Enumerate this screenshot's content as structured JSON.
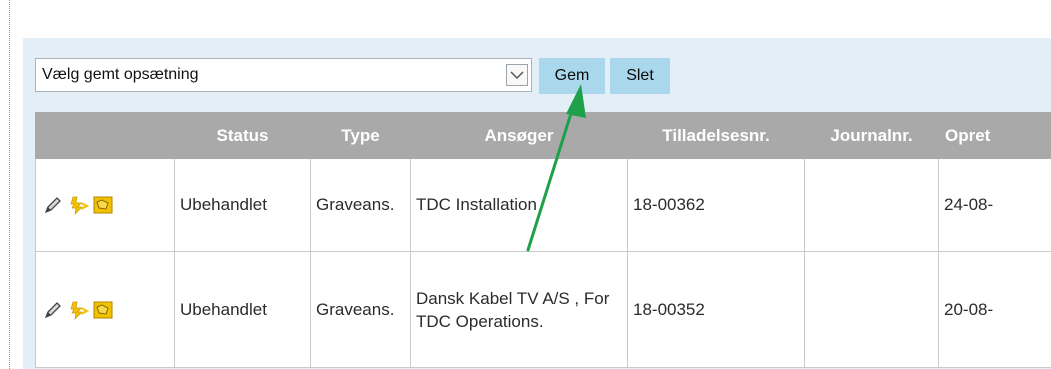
{
  "toolbar": {
    "saved_setup_select": "Vælg gemt opsætning",
    "gem_label": "Gem",
    "slet_label": "Slet"
  },
  "table": {
    "headers": [
      "",
      "Status",
      "Type",
      "Ansøger",
      "Tilladelsesnr.",
      "Journalnr.",
      "Opret"
    ],
    "rows": [
      {
        "status": "Ubehandlet",
        "type": "Graveans.",
        "ansoger": "TDC Installation",
        "tilladelsesnr": "18-00362",
        "journalnr": "",
        "oprettet": "24-08-"
      },
      {
        "status": "Ubehandlet",
        "type": "Graveans.",
        "ansoger": "Dansk Kabel TV A/S , For TDC Operations.",
        "tilladelsesnr": "18-00352",
        "journalnr": "",
        "oprettet": "20-08-"
      }
    ]
  },
  "icons": [
    "pencil-icon",
    "dig-permit-icon",
    "map-icon"
  ],
  "colors": {
    "panel_bg": "#e3eef6",
    "button_bg": "#a9d8ec",
    "header_bg": "#a9a9a9",
    "annotation_arrow": "#1fa04a",
    "icon_yellow": "#f2c200"
  }
}
